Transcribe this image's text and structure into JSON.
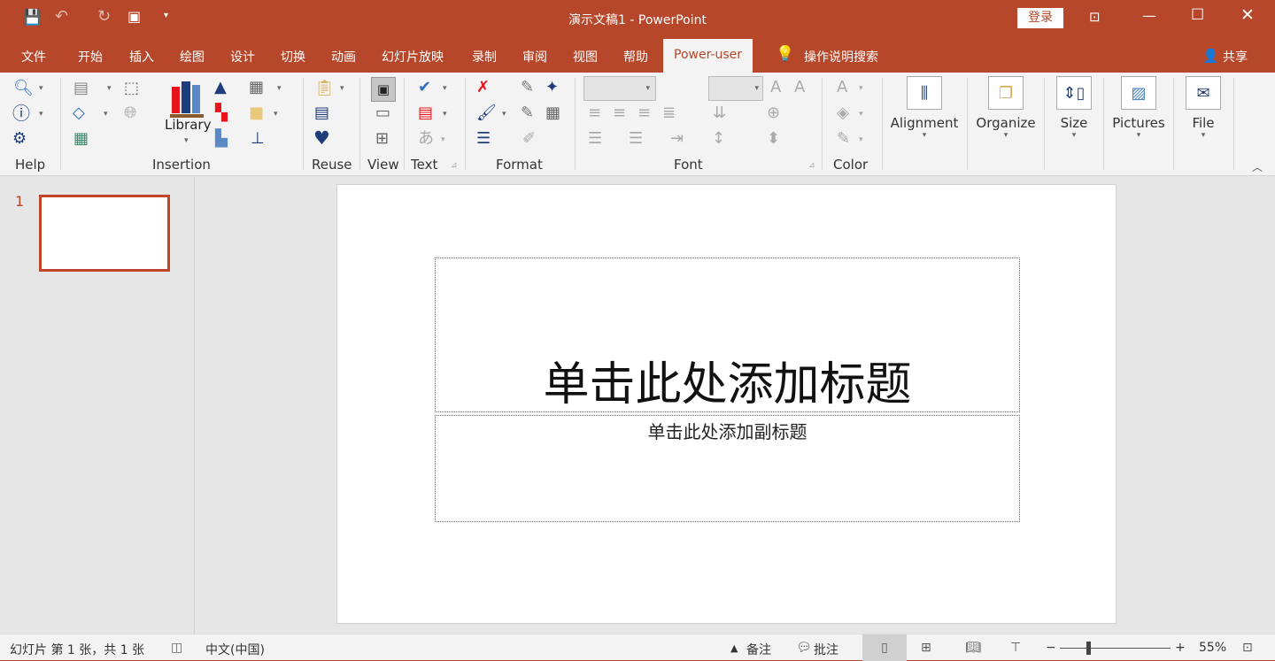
{
  "title_bar": {
    "title": "演示文稿1  -  PowerPoint",
    "login": "登录"
  },
  "tabs": [
    {
      "label": "文件"
    },
    {
      "label": "开始"
    },
    {
      "label": "插入"
    },
    {
      "label": "绘图"
    },
    {
      "label": "设计"
    },
    {
      "label": "切换"
    },
    {
      "label": "动画"
    },
    {
      "label": "幻灯片放映"
    },
    {
      "label": "录制"
    },
    {
      "label": "审阅"
    },
    {
      "label": "视图"
    },
    {
      "label": "帮助"
    },
    {
      "label": "Power-user"
    }
  ],
  "search_tab": "操作说明搜索",
  "share": "共享",
  "ribbon": {
    "groups": {
      "help": "Help",
      "insertion": "Insertion",
      "reuse": "Reuse",
      "view": "View",
      "text": "Text",
      "format": "Format",
      "font": "Font",
      "color": "Color"
    },
    "library": "Library",
    "alignment": "Alignment",
    "organize": "Organize",
    "size": "Size",
    "pictures": "Pictures",
    "file": "File"
  },
  "colors": {
    "accent": "#b7472a",
    "navy": "#1f3d7a",
    "red": "#e8141c"
  },
  "thumbnails": [
    {
      "number": "1"
    }
  ],
  "slide": {
    "title_placeholder": "单击此处添加标题",
    "subtitle_placeholder": "单击此处添加副标题"
  },
  "status": {
    "slide_info": "幻灯片 第 1 张，共 1 张",
    "language": "中文(中国)",
    "notes": "备注",
    "comments": "批注",
    "zoom": "55%",
    "zoom_minus": "−",
    "zoom_plus": "+"
  }
}
